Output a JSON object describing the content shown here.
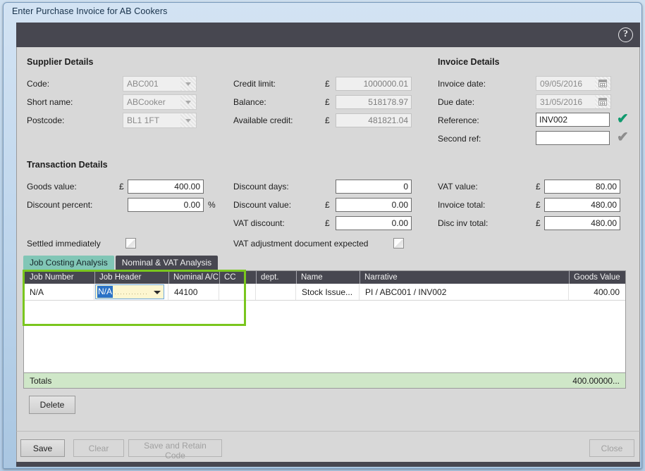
{
  "window": {
    "title": "Enter Purchase Invoice for AB Cookers",
    "help_icon": "help-circle-icon"
  },
  "supplier": {
    "heading": "Supplier Details",
    "fields": [
      {
        "label": "Code:",
        "value": "ABC001"
      },
      {
        "label": "Short name:",
        "value": "ABCooker"
      },
      {
        "label": "Postcode:",
        "value": "BL1 1FT"
      }
    ]
  },
  "credit": {
    "currency": "£",
    "fields": [
      {
        "label": "Credit limit:",
        "value": "1000000.01"
      },
      {
        "label": "Balance:",
        "value": "518178.97"
      },
      {
        "label": "Available credit:",
        "value": "481821.04"
      }
    ]
  },
  "invoice": {
    "heading": "Invoice Details",
    "invoice_date_label": "Invoice date:",
    "invoice_date": "09/05/2016",
    "due_date_label": "Due date:",
    "due_date": "31/05/2016",
    "reference_label": "Reference:",
    "reference": "INV002",
    "second_ref_label": "Second ref:",
    "second_ref": "",
    "second_ref_placeholder": "",
    "tick_valid": "✔",
    "tick_pending": "✔"
  },
  "transaction": {
    "heading": "Transaction Details",
    "currency": "£",
    "percent": "%",
    "goods_value_label": "Goods value:",
    "goods_value": "400.00",
    "discount_percent_label": "Discount percent:",
    "discount_percent": "0.00",
    "settled_label": "Settled immediately",
    "discount_days_label": "Discount days:",
    "discount_days": "0",
    "discount_value_label": "Discount value:",
    "discount_value": "0.00",
    "vat_discount_label": "VAT discount:",
    "vat_discount": "0.00",
    "vat_adjustment_label": "VAT adjustment document expected",
    "vat_value_label": "VAT value:",
    "vat_value": "80.00",
    "invoice_total_label": "Invoice total:",
    "invoice_total": "480.00",
    "disc_inv_total_label": "Disc inv total:",
    "disc_inv_total": "480.00"
  },
  "tabs": [
    {
      "label": "Job Costing Analysis",
      "active": true
    },
    {
      "label": "Nominal & VAT Analysis",
      "active": false
    }
  ],
  "grid": {
    "columns": [
      "Job Number",
      "Job Header",
      "Nominal A/C",
      "CC",
      "dept.",
      "Name",
      "Narrative",
      "Goods Value"
    ],
    "row": {
      "job_number": "N/A",
      "job_header": "N/A",
      "nominal_ac": "44100",
      "cc": "",
      "dept": "",
      "name": "Stock Issue...",
      "narrative": "PI / ABC001 / INV002",
      "goods_value": "400.00"
    },
    "totals_label": "Totals",
    "totals_value": "400.00000...",
    "delete_label": "Delete"
  },
  "footer": {
    "save_label": "Save",
    "clear_label": "Clear",
    "save_retain_label": "Save and Retain Code",
    "close_label": "Close"
  },
  "colors": {
    "accent_green": "#7ac61e",
    "tab_active": "#81c6b6",
    "header_dark": "#474750",
    "totals_green": "#cfe7c8",
    "tick_green": "#0f9a6e"
  }
}
